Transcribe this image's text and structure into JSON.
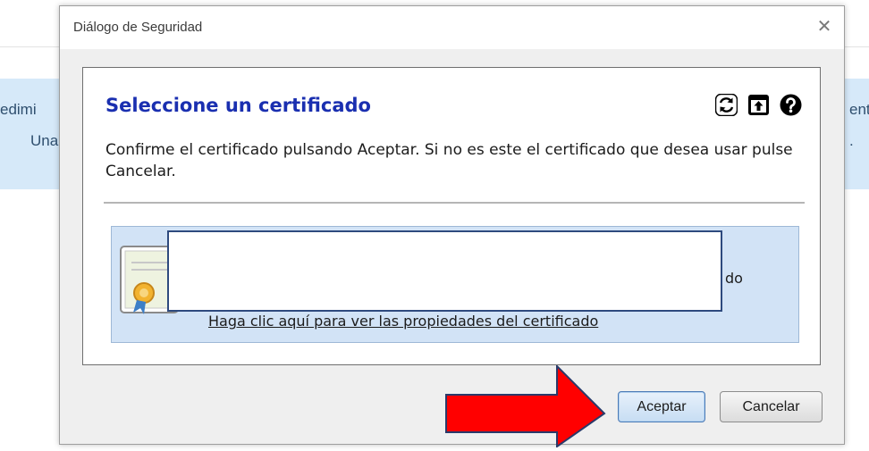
{
  "background": {
    "left_text_line1": "edimi",
    "left_text_line2": "Una",
    "right_text_line1": "ent",
    "right_text_line2": "."
  },
  "dialog": {
    "title": "Diálogo de Seguridad",
    "close_glyph": "✕",
    "heading": "Seleccione un certificado",
    "description": "Confirme el certificado pulsando Aceptar. Si no es este el certificado que desea usar pulse Cancelar.",
    "toolbar_icons": [
      "refresh-icon",
      "import-icon",
      "help-icon"
    ],
    "certificate": {
      "partial_text": "do",
      "details_link": "Haga clic aquí para ver las propiedades del certificado"
    },
    "buttons": {
      "accept": "Aceptar",
      "cancel": "Cancelar"
    }
  },
  "colors": {
    "heading": "#1a2fb0",
    "banner_bg": "#d6e9f9",
    "certificate_bg": "#d2e3f6",
    "arrow": "#ff0000"
  }
}
